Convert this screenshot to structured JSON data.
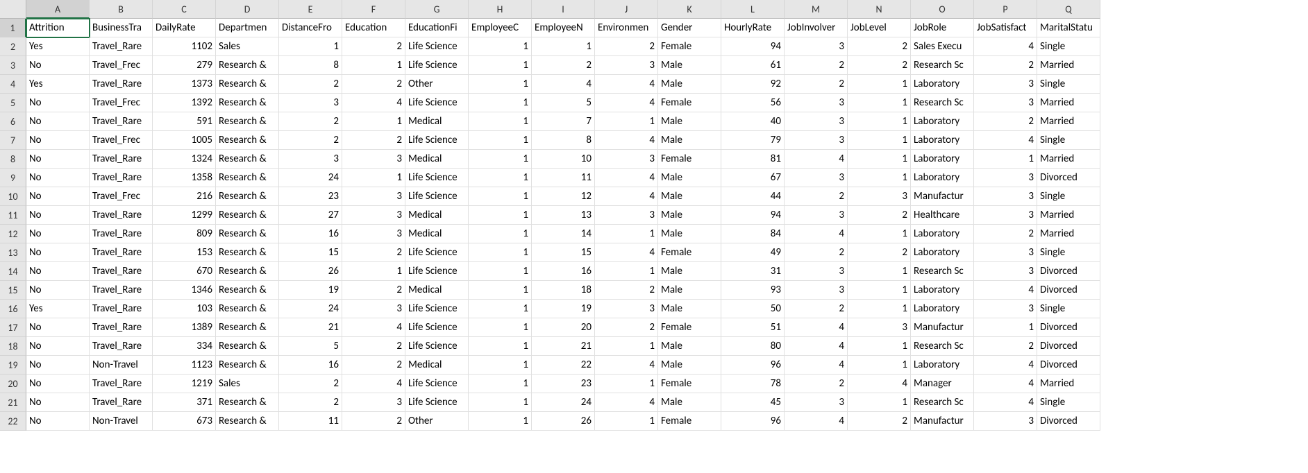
{
  "columns_letters": [
    "A",
    "B",
    "C",
    "D",
    "E",
    "F",
    "G",
    "H",
    "I",
    "J",
    "K",
    "L",
    "M",
    "N",
    "O",
    "P",
    "Q"
  ],
  "selected_cell": {
    "row": 1,
    "col": 0
  },
  "numeric_cols": [
    2,
    4,
    5,
    7,
    8,
    9,
    11,
    12,
    13,
    15
  ],
  "headers": [
    "Attrition",
    "BusinessTravel",
    "DailyRate",
    "Department",
    "DistanceFromHome",
    "Education",
    "EducationField",
    "EmployeeCount",
    "EmployeeNumber",
    "EnvironmentSatisfaction",
    "Gender",
    "HourlyRate",
    "JobInvolvement",
    "JobLevel",
    "JobRole",
    "JobSatisfaction",
    "MaritalStatus"
  ],
  "rows": [
    [
      "Yes",
      "Travel_Rarely",
      1102,
      "Sales",
      1,
      2,
      "Life Sciences",
      1,
      1,
      2,
      "Female",
      94,
      3,
      2,
      "Sales Executive",
      4,
      "Single"
    ],
    [
      "No",
      "Travel_Frequently",
      279,
      "Research & Development",
      8,
      1,
      "Life Sciences",
      1,
      2,
      3,
      "Male",
      61,
      2,
      2,
      "Research Scientist",
      2,
      "Married"
    ],
    [
      "Yes",
      "Travel_Rarely",
      1373,
      "Research & Development",
      2,
      2,
      "Other",
      1,
      4,
      4,
      "Male",
      92,
      2,
      1,
      "Laboratory Technician",
      3,
      "Single"
    ],
    [
      "No",
      "Travel_Frequently",
      1392,
      "Research & Development",
      3,
      4,
      "Life Sciences",
      1,
      5,
      4,
      "Female",
      56,
      3,
      1,
      "Research Scientist",
      3,
      "Married"
    ],
    [
      "No",
      "Travel_Rarely",
      591,
      "Research & Development",
      2,
      1,
      "Medical",
      1,
      7,
      1,
      "Male",
      40,
      3,
      1,
      "Laboratory Technician",
      2,
      "Married"
    ],
    [
      "No",
      "Travel_Frequently",
      1005,
      "Research & Development",
      2,
      2,
      "Life Sciences",
      1,
      8,
      4,
      "Male",
      79,
      3,
      1,
      "Laboratory Technician",
      4,
      "Single"
    ],
    [
      "No",
      "Travel_Rarely",
      1324,
      "Research & Development",
      3,
      3,
      "Medical",
      1,
      10,
      3,
      "Female",
      81,
      4,
      1,
      "Laboratory Technician",
      1,
      "Married"
    ],
    [
      "No",
      "Travel_Rarely",
      1358,
      "Research & Development",
      24,
      1,
      "Life Sciences",
      1,
      11,
      4,
      "Male",
      67,
      3,
      1,
      "Laboratory Technician",
      3,
      "Divorced"
    ],
    [
      "No",
      "Travel_Frequently",
      216,
      "Research & Development",
      23,
      3,
      "Life Sciences",
      1,
      12,
      4,
      "Male",
      44,
      2,
      3,
      "Manufacturing Director",
      3,
      "Single"
    ],
    [
      "No",
      "Travel_Rarely",
      1299,
      "Research & Development",
      27,
      3,
      "Medical",
      1,
      13,
      3,
      "Male",
      94,
      3,
      2,
      "Healthcare Representative",
      3,
      "Married"
    ],
    [
      "No",
      "Travel_Rarely",
      809,
      "Research & Development",
      16,
      3,
      "Medical",
      1,
      14,
      1,
      "Male",
      84,
      4,
      1,
      "Laboratory Technician",
      2,
      "Married"
    ],
    [
      "No",
      "Travel_Rarely",
      153,
      "Research & Development",
      15,
      2,
      "Life Sciences",
      1,
      15,
      4,
      "Female",
      49,
      2,
      2,
      "Laboratory Technician",
      3,
      "Single"
    ],
    [
      "No",
      "Travel_Rarely",
      670,
      "Research & Development",
      26,
      1,
      "Life Sciences",
      1,
      16,
      1,
      "Male",
      31,
      3,
      1,
      "Research Scientist",
      3,
      "Divorced"
    ],
    [
      "No",
      "Travel_Rarely",
      1346,
      "Research & Development",
      19,
      2,
      "Medical",
      1,
      18,
      2,
      "Male",
      93,
      3,
      1,
      "Laboratory Technician",
      4,
      "Divorced"
    ],
    [
      "Yes",
      "Travel_Rarely",
      103,
      "Research & Development",
      24,
      3,
      "Life Sciences",
      1,
      19,
      3,
      "Male",
      50,
      2,
      1,
      "Laboratory Technician",
      3,
      "Single"
    ],
    [
      "No",
      "Travel_Rarely",
      1389,
      "Research & Development",
      21,
      4,
      "Life Sciences",
      1,
      20,
      2,
      "Female",
      51,
      4,
      3,
      "Manufacturing Director",
      1,
      "Divorced"
    ],
    [
      "No",
      "Travel_Rarely",
      334,
      "Research & Development",
      5,
      2,
      "Life Sciences",
      1,
      21,
      1,
      "Male",
      80,
      4,
      1,
      "Research Scientist",
      2,
      "Divorced"
    ],
    [
      "No",
      "Non-Travel",
      1123,
      "Research & Development",
      16,
      2,
      "Medical",
      1,
      22,
      4,
      "Male",
      96,
      4,
      1,
      "Laboratory Technician",
      4,
      "Divorced"
    ],
    [
      "No",
      "Travel_Rarely",
      1219,
      "Sales",
      2,
      4,
      "Life Sciences",
      1,
      23,
      1,
      "Female",
      78,
      2,
      4,
      "Manager",
      4,
      "Married"
    ],
    [
      "No",
      "Travel_Rarely",
      371,
      "Research & Development",
      2,
      3,
      "Life Sciences",
      1,
      24,
      4,
      "Male",
      45,
      3,
      1,
      "Research Scientist",
      4,
      "Single"
    ],
    [
      "No",
      "Non-Travel",
      673,
      "Research & Development",
      11,
      2,
      "Other",
      1,
      26,
      1,
      "Female",
      96,
      4,
      2,
      "Manufacturing Director",
      3,
      "Divorced"
    ]
  ],
  "display_trunc": {
    "1": {
      "Travel_Rarely": "Travel_Rare",
      "Travel_Frequently": "Travel_Frec",
      "Non-Travel": "Non-Travel"
    },
    "3": {
      "Research & Development": "Research &",
      "Sales": "Sales"
    },
    "6": {
      "Life Sciences": "Life Science",
      "Medical": "Medical",
      "Other": "Other"
    },
    "14": {
      "Sales Executive": "Sales Execu",
      "Research Scientist": "Research Sc",
      "Laboratory Technician": "Laboratory",
      "Manufacturing Director": "Manufactur",
      "Healthcare Representative": "Healthcare",
      "Manager": "Manager"
    }
  },
  "header_display": [
    "Attrition",
    "BusinessTra",
    "DailyRate",
    "Departmen",
    "DistanceFro",
    "Education",
    "EducationFi",
    "EmployeeC",
    "EmployeeN",
    "Environmen",
    "Gender",
    "HourlyRate",
    "JobInvolver",
    "JobLevel",
    "JobRole",
    "JobSatisfact",
    "MaritalStatu"
  ]
}
